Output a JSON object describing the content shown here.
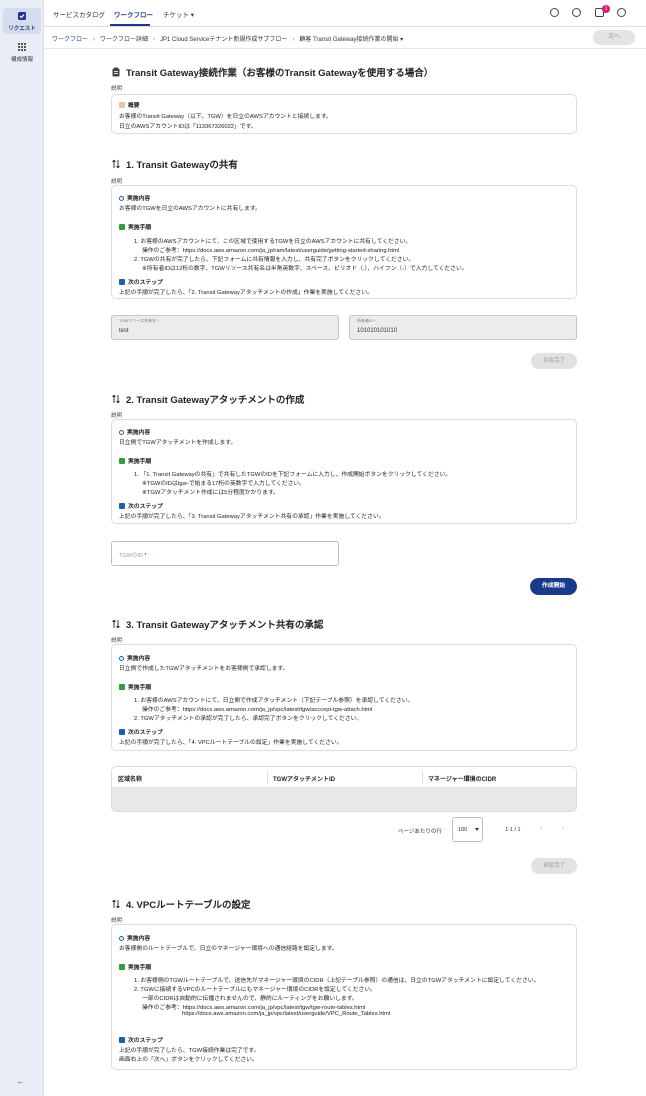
{
  "rail": {
    "items": [
      {
        "label": "リクエスト",
        "icon": "request-icon"
      },
      {
        "label": "構成情報",
        "icon": "grid-icon"
      }
    ],
    "back": "←"
  },
  "topbar": {
    "tabs": [
      "サービスカタログ",
      "ワークフロー",
      "チケット ▾"
    ],
    "notification_count": "1"
  },
  "breadcrumb": {
    "items": [
      "ワークフロー",
      "ワークフロー詳細",
      "JP1 Cloud Serviceテナント新規作成サブフロー",
      "顧客 Transit Gateway接続作業の開始 ▾"
    ],
    "separator": "›",
    "next_button": "次へ"
  },
  "intro": {
    "title": "Transit Gateway接続作業（お客様のTransit Gatewayを使用する場合）",
    "label": "説明",
    "heading": "概要",
    "line1": "お客様のTransit Gateway（以下、TGW）を日立のAWSアカウントと接続します。",
    "line2": "日立のAWSアカウントIDは「113367326022」です。"
  },
  "s1": {
    "title": "1. Transit Gatewayの共有",
    "label": "説明",
    "what_h": "実施内容",
    "what": "お客様のTGWを日立のAWSアカウントに共有します。",
    "steps_h": "実施手順",
    "steps": [
      "1. お客様のAWSアカウントにて、この区域で使用するTGWを日立のAWSアカウントに共有してください。",
      "操作のご参考：https://docs.aws.amazon.com/ja_jp/ram/latest/userguide/getting-started-sharing.html",
      "2. TGWの共有が完了したら、下記フォームに共有情報を入力し、共有完了ボタンをクリックしてください。",
      "※所有者IDは12桁の数字、TGWリソース共有名は半角英数字、スペース、ピリオド（.）、ハイフン（-）で入力してください。"
    ],
    "next_h": "次のステップ",
    "next": "上記の手順が完了したら、「2. Transit Gatewayアタッチメントの作成」作業を実施してください。",
    "field1_label": "TGWリソース共有名 *",
    "field1_value": "test",
    "field2_label": "所有者ID *",
    "field2_value": "101010101010",
    "button": "共有完了"
  },
  "s2": {
    "title": "2. Transit Gatewayアタッチメントの作成",
    "label": "説明",
    "what_h": "実施内容",
    "what": "日立側でTGWアタッチメントを作成します。",
    "steps_h": "実施手順",
    "steps": [
      "1. 「1. Transit Gatewayの共有」で共有したTGWのIDを下記フォームに入力し、作成開始ボタンをクリックしてください。",
      "※TGWのIDはtgw-で始まる17桁の英数字で入力してください。",
      "※TGWアタッチメント作成には5分程度かかります。"
    ],
    "next_h": "次のステップ",
    "next": "上記の手順が完了したら、「3. Transit Gatewayアタッチメント共有の承認」作業を実施してください。",
    "field_placeholder": "TGWのID",
    "field_required": " *",
    "button": "作成開始"
  },
  "s3": {
    "title": "3. Transit Gatewayアタッチメント共有の承認",
    "label": "説明",
    "what_h": "実施内容",
    "what": "日立側で作成したTGWアタッチメントをお客様側で承認します。",
    "steps_h": "実施手順",
    "steps": [
      "1. お客様のAWSアカウントにて、日立側で作成アタッチメント（下記テーブル参照）を承認してください。",
      "操作のご参考：https://docs.aws.amazon.com/ja_jp/vpc/latest/tgw/acccept-tgw-attach.html",
      "2. TGWアタッチメントの承認が完了したら、承認完了ボタンをクリックしてください。"
    ],
    "next_h": "次のステップ",
    "next": "上記の手順が完了したら、「4. VPCルートテーブルの設定」作業を実施してください。",
    "table_headers": [
      "区域名称",
      "TGWアタッチメントID",
      "マネージャー環境のCIDR"
    ],
    "rows_per_page_label": "ページあたりの行",
    "rows_per_page": "100",
    "range": "1-1 / 1",
    "prev": "‹",
    "next_page": "›",
    "button": "承認完了"
  },
  "s4": {
    "title": "4. VPCルートテーブルの設定",
    "label": "説明",
    "what_h": "実施内容",
    "what": "お客様側のルートテーブルで、日立のマネージャー環境への通信経路を設定します。",
    "steps_h": "実施手順",
    "steps": [
      "1. お客様側のTGWルートテーブルで、送信先がマネージャー環境のCIDR（上記テーブル参照）の通信は、日立のTGWアタッチメントに設定してください。",
      "2. TGWに接続するVPCのルートテーブルにもマネージャー環境のCIDRを設定してください。",
      "一部のCIDRは自動的に伝播されませんので、静的にルーティングをお願いします。",
      "操作のご参考：https://docs.aws.amazon.com/ja_jp/vpc/latest/tgw/tgw-route-tables.html",
      "https://docs.aws.amazon.com/ja_jp/vpc/latest/userguide/VPC_Route_Tables.html"
    ],
    "next_h": "次のステップ",
    "next1": "上記の手順が完了したら、TGW接続作業は完了です。",
    "next2": "画面右上の「次へ」ボタンをクリックしてください。"
  }
}
